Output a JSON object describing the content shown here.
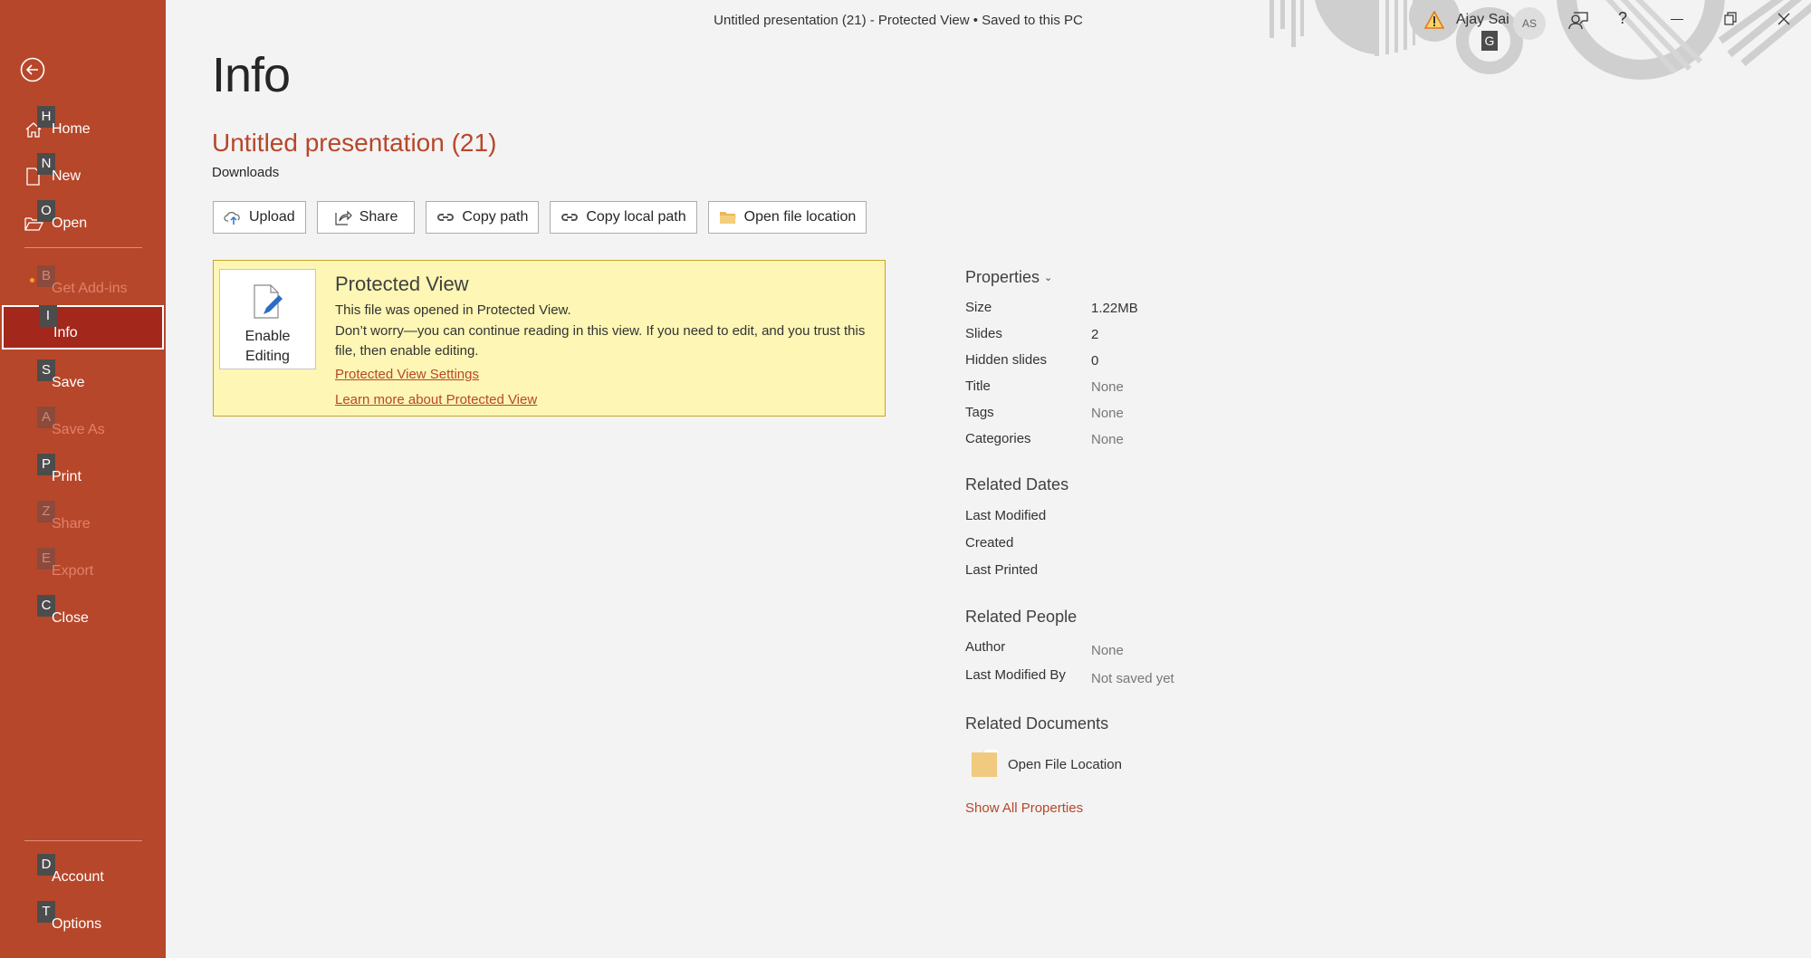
{
  "window": {
    "title": "Untitled presentation (21)  -  Protected View • Saved to this PC",
    "user_name": "Ajay Sai",
    "user_initials": "AS",
    "user_keytip": "G",
    "icons": [
      "warning-icon",
      "coauthor-icon",
      "help-icon",
      "minimize-icon",
      "restore-icon",
      "close-icon"
    ],
    "help_label": "?"
  },
  "sidebar": {
    "back_icon": "back-arrow-icon",
    "items": [
      {
        "key": "H",
        "label": "Home",
        "icon": "home-icon",
        "enabled": true
      },
      {
        "key": "N",
        "label": "New",
        "icon": "new-doc-icon",
        "enabled": true
      },
      {
        "key": "O",
        "label": "Open",
        "icon": "folder-open-icon",
        "enabled": true
      },
      {
        "key": "B",
        "label": "Get Add-ins",
        "enabled": false
      },
      {
        "key": "I",
        "label": "Info",
        "enabled": true,
        "active": true
      },
      {
        "key": "S",
        "label": "Save",
        "enabled": true
      },
      {
        "key": "A",
        "label": "Save As",
        "enabled": false
      },
      {
        "key": "P",
        "label": "Print",
        "enabled": true
      },
      {
        "key": "Z",
        "label": "Share",
        "enabled": false
      },
      {
        "key": "E",
        "label": "Export",
        "enabled": false
      },
      {
        "key": "C",
        "label": "Close",
        "enabled": true
      },
      {
        "key": "D",
        "label": "Account",
        "enabled": true
      },
      {
        "key": "T",
        "label": "Options",
        "enabled": true
      }
    ]
  },
  "main": {
    "page_title": "Info",
    "doc_name": "Untitled presentation (21)",
    "doc_location": "Downloads",
    "buttons": [
      {
        "label": "Upload",
        "icon": "cloud-upload-icon"
      },
      {
        "label": "Share",
        "icon": "share-icon"
      },
      {
        "label": "Copy path",
        "icon": "link-icon"
      },
      {
        "label": "Copy local path",
        "icon": "link-icon"
      },
      {
        "label": "Open file location",
        "icon": "folder-icon"
      }
    ],
    "protected_view": {
      "enable_label_1": "Enable",
      "enable_label_2": "Editing",
      "title": "Protected View",
      "line1": "This file was opened in Protected View.",
      "line2": "Don’t worry—you can continue reading in this view. If you need to edit, and you trust this file, then enable editing.",
      "link1": "Protected View Settings",
      "link2": "Learn more about Protected View"
    }
  },
  "properties": {
    "title": "Properties",
    "rows": [
      {
        "key": "Size",
        "value": "1.22MB"
      },
      {
        "key": "Slides",
        "value": "2"
      },
      {
        "key": "Hidden slides",
        "value": "0"
      },
      {
        "key": "Title",
        "value": "None"
      },
      {
        "key": "Tags",
        "value": "None"
      },
      {
        "key": "Categories",
        "value": "None"
      }
    ],
    "related_dates": {
      "title": "Related Dates",
      "rows": [
        "Last Modified",
        "Created",
        "Last Printed"
      ]
    },
    "related_people": {
      "title": "Related People",
      "rows": [
        {
          "key": "Author",
          "value": "None"
        },
        {
          "key": "Last Modified By",
          "value": "Not saved yet"
        }
      ]
    },
    "related_documents": {
      "title": "Related Documents",
      "open_file_location": "Open File Location"
    },
    "show_all": "Show All Properties"
  },
  "colors": {
    "accent": "#b7472a",
    "active_nav": "#a4271c",
    "banner_bg": "#fdf6b4",
    "banner_border": "#c8a52c",
    "background": "#f3f3f3"
  }
}
